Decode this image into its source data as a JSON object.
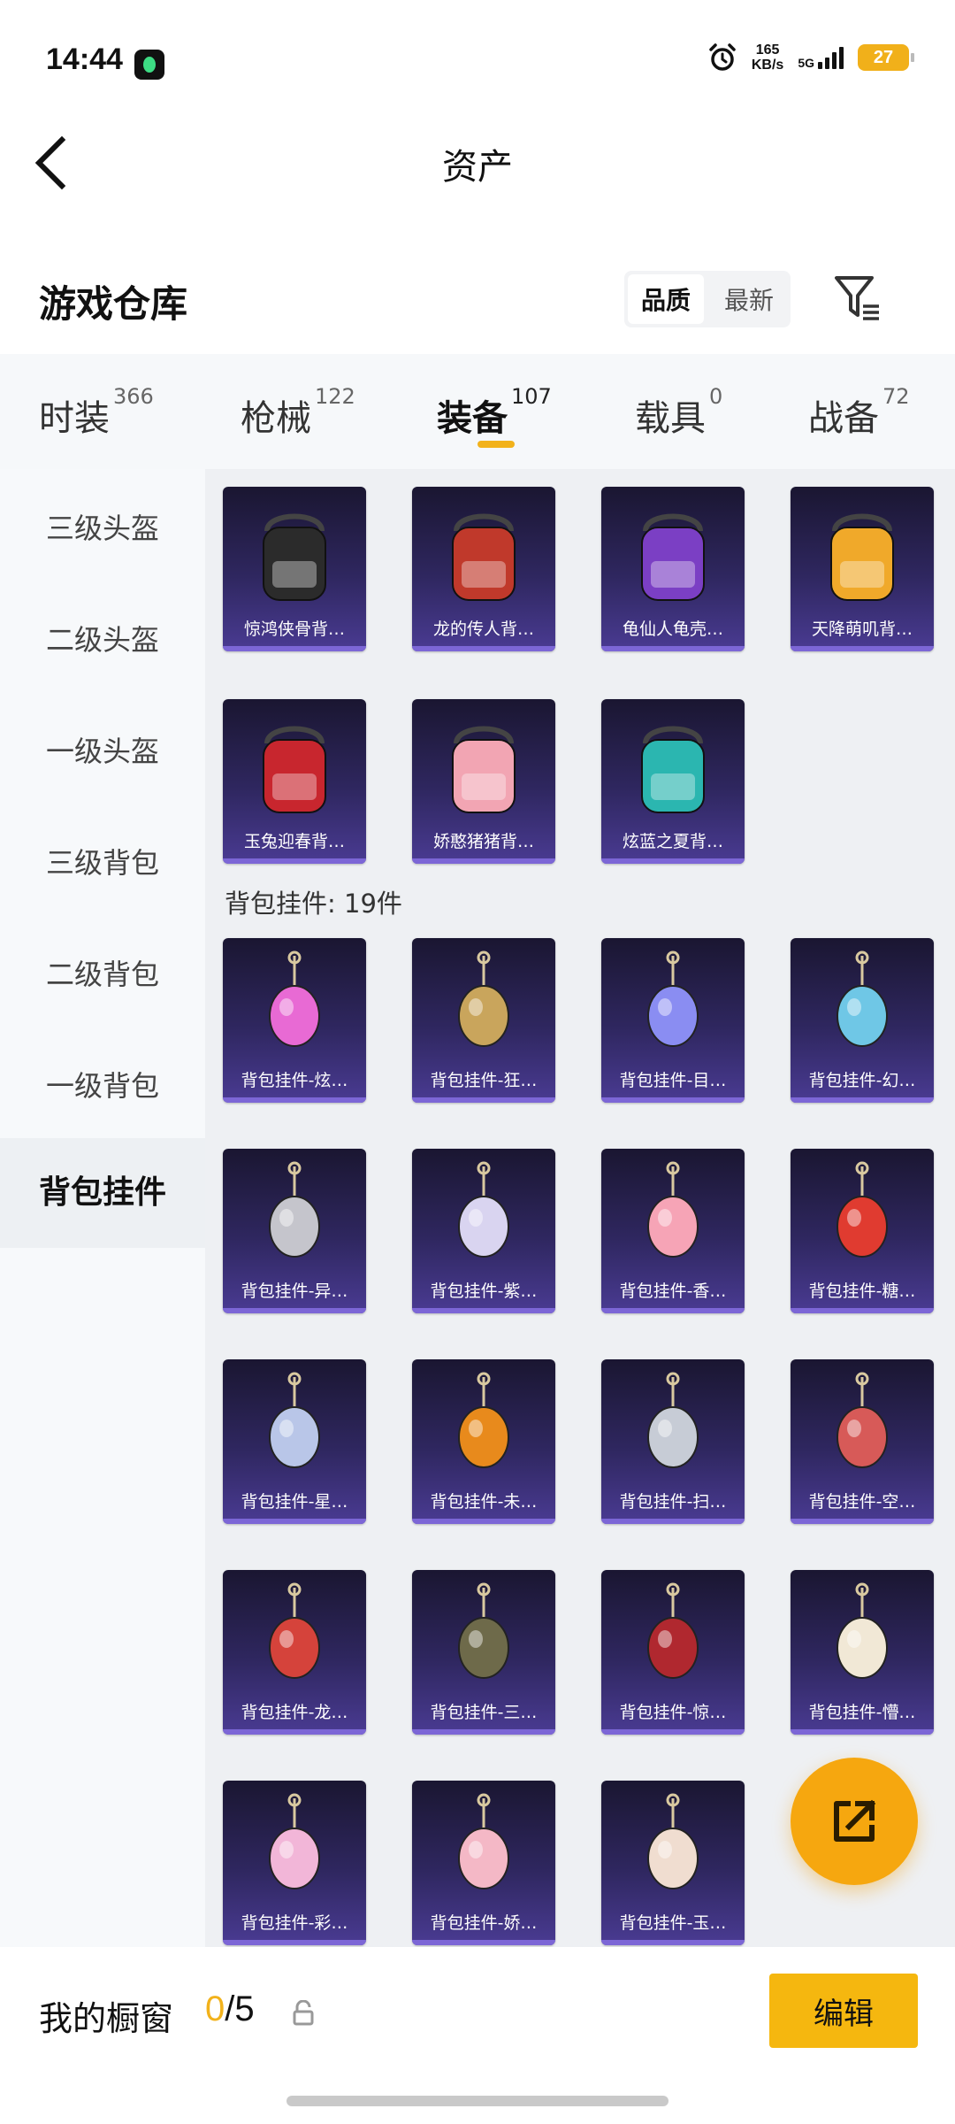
{
  "status_bar": {
    "time": "14:44",
    "net_speed_value": "165",
    "net_speed_unit": "KB/s",
    "network": "5G",
    "battery": "27"
  },
  "header": {
    "title": "资产"
  },
  "section": {
    "title": "游戏仓库",
    "sort_options": [
      "品质",
      "最新"
    ],
    "active_sort": 0
  },
  "tabs": [
    {
      "label": "时装",
      "count": "366"
    },
    {
      "label": "枪械",
      "count": "122"
    },
    {
      "label": "装备",
      "count": "107"
    },
    {
      "label": "载具",
      "count": "0"
    },
    {
      "label": "战备",
      "count": "72"
    }
  ],
  "sidebar": {
    "items": [
      "三级头盔",
      "二级头盔",
      "一级头盔",
      "三级背包",
      "二级背包",
      "一级背包",
      "背包挂件"
    ],
    "active": "背包挂件"
  },
  "backpacks": [
    {
      "name": "惊鸿侠骨背…",
      "art": "backpack-black",
      "color": "#2b2b2b"
    },
    {
      "name": "龙的传人背…",
      "art": "backpack-red-white",
      "color": "#c0392b"
    },
    {
      "name": "龟仙人龟壳…",
      "art": "backpack-purple",
      "color": "#7b3fc4"
    },
    {
      "name": "天降萌叽背…",
      "art": "backpack-yellow",
      "color": "#f0a92a"
    },
    {
      "name": "玉兔迎春背…",
      "art": "backpack-red",
      "color": "#c8262e"
    },
    {
      "name": "娇憨猪猪背…",
      "art": "backpack-pink-pig",
      "color": "#f2a5b3"
    },
    {
      "name": "炫蓝之夏背…",
      "art": "backpack-teal",
      "color": "#2bb6b0"
    }
  ],
  "pendant_header": "背包挂件: 19件",
  "pendants": [
    {
      "name": "背包挂件-炫…",
      "art": "candy-pendant",
      "color": "#e86ad4"
    },
    {
      "name": "背包挂件-狂…",
      "art": "claw-pendant",
      "color": "#c9a55c"
    },
    {
      "name": "背包挂件-目…",
      "art": "ring-pendant",
      "color": "#8a8df2"
    },
    {
      "name": "背包挂件-幻…",
      "art": "robot-pendant",
      "color": "#6fc7e6"
    },
    {
      "name": "背包挂件-异…",
      "art": "wings-pendant",
      "color": "#c5c5cc"
    },
    {
      "name": "背包挂件-紫…",
      "art": "bell-pendant",
      "color": "#d9d4f0"
    },
    {
      "name": "背包挂件-香…",
      "art": "flower-pendant",
      "color": "#f6a4b6"
    },
    {
      "name": "背包挂件-糖…",
      "art": "gourd-pendant",
      "color": "#e03b30"
    },
    {
      "name": "背包挂件-星…",
      "art": "rocket-pendant",
      "color": "#b9c6e8"
    },
    {
      "name": "背包挂件-未…",
      "art": "orb-pendant",
      "color": "#e88a1c"
    },
    {
      "name": "背包挂件-扫…",
      "art": "ghost-pendant",
      "color": "#c7ccd6"
    },
    {
      "name": "背包挂件-空…",
      "art": "gun-pendant",
      "color": "#d75a58"
    },
    {
      "name": "背包挂件-龙…",
      "art": "lion-pendant",
      "color": "#d5433b"
    },
    {
      "name": "背包挂件-三…",
      "art": "helmet-pendant",
      "color": "#6e6a4a"
    },
    {
      "name": "背包挂件-惊…",
      "art": "tassel-pendant",
      "color": "#b0282f"
    },
    {
      "name": "背包挂件-懵…",
      "art": "leaf-pendant",
      "color": "#f1e8d6"
    },
    {
      "name": "背包挂件-彩…",
      "art": "paw-pendant",
      "color": "#f2b6d8"
    },
    {
      "name": "背包挂件-娇…",
      "art": "pig-pendant",
      "color": "#f4b8c6"
    },
    {
      "name": "背包挂件-玉…",
      "art": "rabbit-pendant",
      "color": "#f0ddd0"
    }
  ],
  "bottom_bar": {
    "label": "我的橱窗",
    "current": "0",
    "separator": "/",
    "max": "5",
    "edit_label": "编辑"
  }
}
